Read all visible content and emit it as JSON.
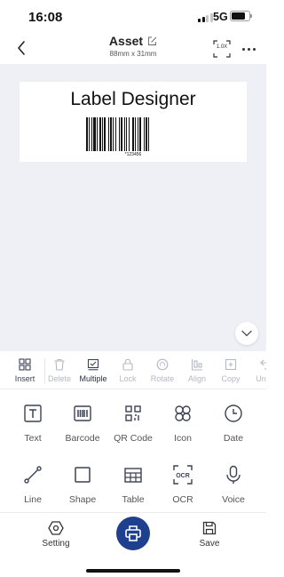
{
  "status": {
    "time": "16:08",
    "network": "5G"
  },
  "nav": {
    "title": "Asset",
    "subtitle": "88mm x 31mm",
    "zoom_label": "1.0X"
  },
  "label": {
    "text": "Label Designer",
    "barcode_number": "*123456"
  },
  "edit_toolbar": [
    {
      "label": "Insert",
      "state": "active",
      "icon": "insert-grid-icon"
    },
    {
      "label": "Delete",
      "state": "disabled",
      "icon": "trash-icon"
    },
    {
      "label": "Multiple",
      "state": "enabled",
      "icon": "multi-select-icon"
    },
    {
      "label": "Lock",
      "state": "disabled",
      "icon": "lock-icon"
    },
    {
      "label": "Rotate",
      "state": "disabled",
      "icon": "rotate-icon"
    },
    {
      "label": "Align",
      "state": "disabled",
      "icon": "align-icon"
    },
    {
      "label": "Copy",
      "state": "disabled",
      "icon": "copy-icon"
    },
    {
      "label": "Undo",
      "state": "disabled",
      "icon": "undo-icon"
    }
  ],
  "insert_items": [
    {
      "label": "Text",
      "icon": "text-icon"
    },
    {
      "label": "Barcode",
      "icon": "barcode-icon"
    },
    {
      "label": "QR Code",
      "icon": "qr-code-icon"
    },
    {
      "label": "Icon",
      "icon": "icon-library-icon"
    },
    {
      "label": "Date",
      "icon": "clock-icon"
    },
    {
      "label": "Line",
      "icon": "line-icon"
    },
    {
      "label": "Shape",
      "icon": "square-icon"
    },
    {
      "label": "Table",
      "icon": "table-icon"
    },
    {
      "label": "OCR",
      "icon": "ocr-scan-icon"
    },
    {
      "label": "Voice",
      "icon": "microphone-icon"
    }
  ],
  "bottom_bar": {
    "setting_label": "Setting",
    "save_label": "Save"
  },
  "colors": {
    "canvas_bg": "#eef0f5",
    "primary": "#1f3f8f",
    "disabled": "#b3b8c4"
  }
}
